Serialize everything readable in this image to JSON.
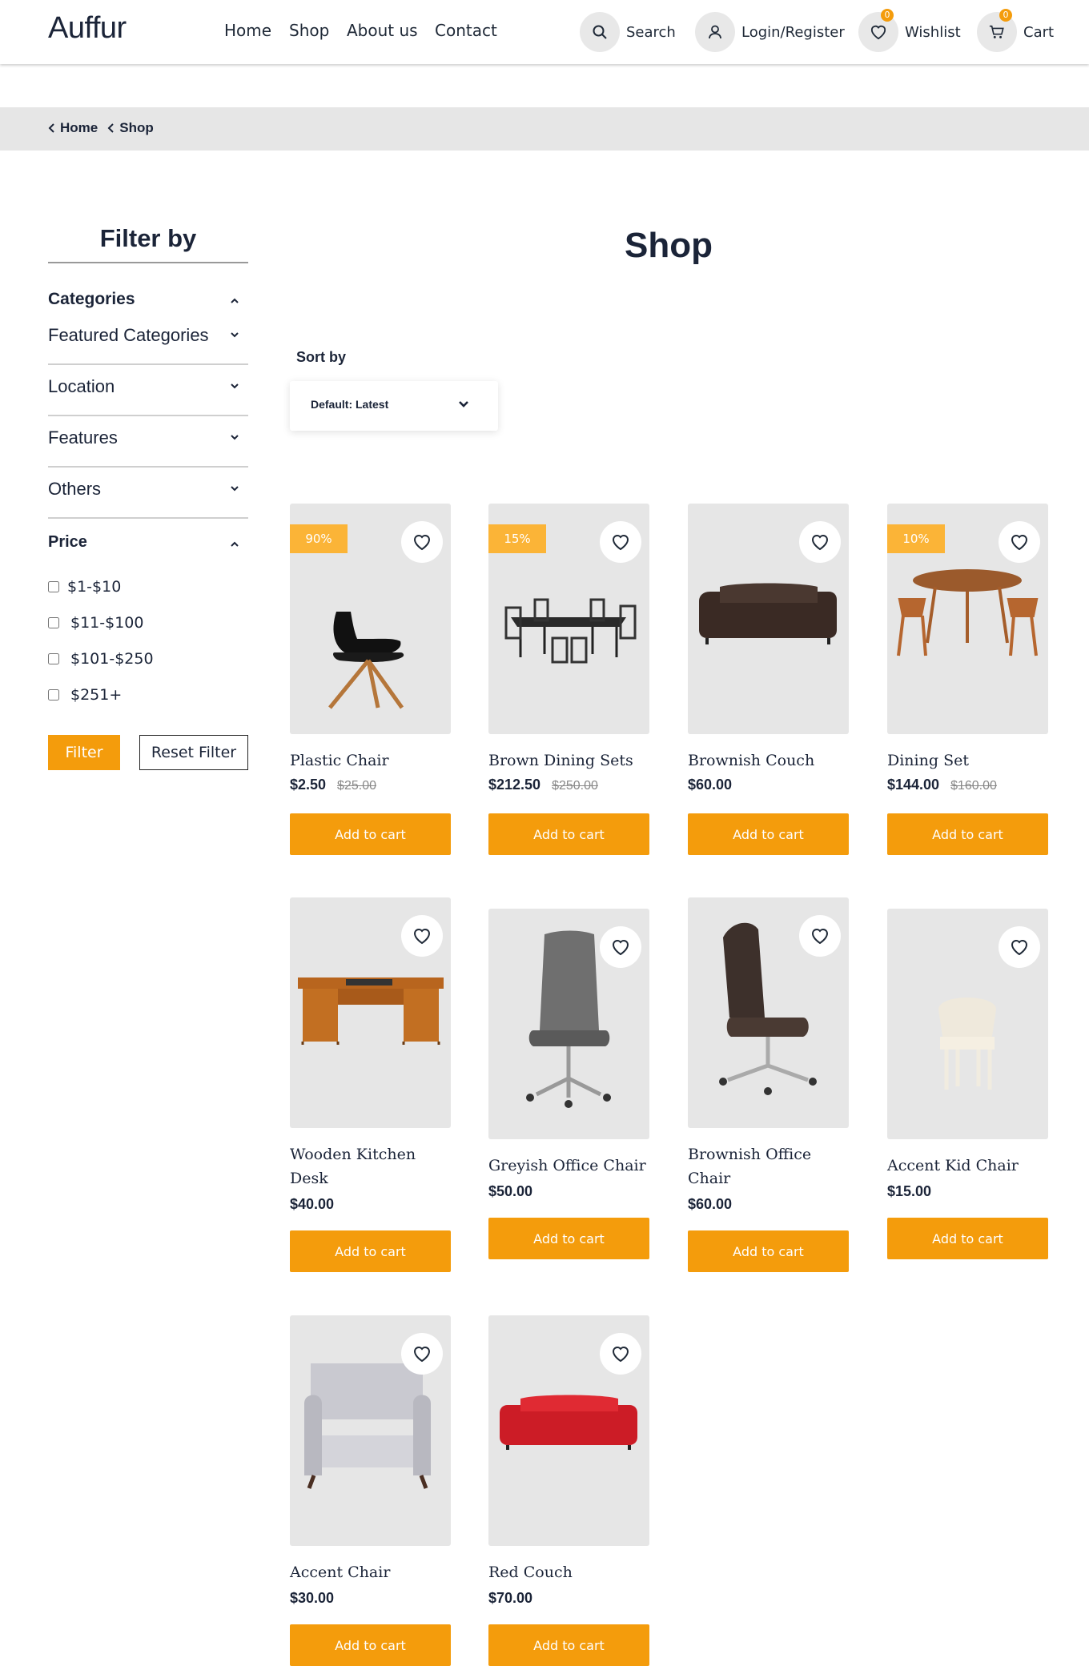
{
  "header": {
    "logo": "Auffur",
    "nav": [
      "Home",
      "Shop",
      "About us",
      "Contact"
    ],
    "search_label": "Search",
    "account_label": "Login/Register",
    "wishlist_label": "Wishlist",
    "wishlist_count": "0",
    "cart_label": "Cart",
    "cart_count": "0"
  },
  "breadcrumb": [
    "Home",
    "Shop"
  ],
  "sidebar": {
    "title": "Filter by",
    "categories_label": "Categories",
    "facets": [
      "Featured Categories",
      "Location",
      "Features",
      "Others"
    ],
    "price_label": "Price",
    "price_options": [
      "$1-$10",
      "$11-$100",
      "$101-$250",
      "$251+"
    ],
    "filter_button": "Filter",
    "reset_button": "Reset Filter"
  },
  "main": {
    "title": "Shop",
    "sort_label": "Sort by",
    "sort_value": "Default: Latest",
    "add_to_cart": "Add to cart",
    "products": [
      {
        "name": "Plastic Chair",
        "price": "$2.50",
        "old_price": "$25.00",
        "discount": "90%"
      },
      {
        "name": "Brown Dining Sets",
        "price": "$212.50",
        "old_price": "$250.00",
        "discount": "15%"
      },
      {
        "name": "Brownish Couch",
        "price": "$60.00",
        "old_price": "",
        "discount": ""
      },
      {
        "name": "Dining Set",
        "price": "$144.00",
        "old_price": "$160.00",
        "discount": "10%"
      },
      {
        "name": "Wooden Kitchen Desk",
        "price": "$40.00",
        "old_price": "",
        "discount": ""
      },
      {
        "name": "Greyish Office Chair",
        "price": "$50.00",
        "old_price": "",
        "discount": ""
      },
      {
        "name": "Brownish Office Chair",
        "price": "$60.00",
        "old_price": "",
        "discount": ""
      },
      {
        "name": "Accent Kid Chair",
        "price": "$15.00",
        "old_price": "",
        "discount": ""
      },
      {
        "name": "Accent Chair",
        "price": "$30.00",
        "old_price": "",
        "discount": ""
      },
      {
        "name": "Red Couch",
        "price": "$70.00",
        "old_price": "",
        "discount": ""
      }
    ]
  },
  "colors": {
    "accent": "#f49c0c",
    "discount_badge": "#fbb437",
    "text_dark": "#1b2438",
    "tile_bg": "#e6e6e6"
  }
}
